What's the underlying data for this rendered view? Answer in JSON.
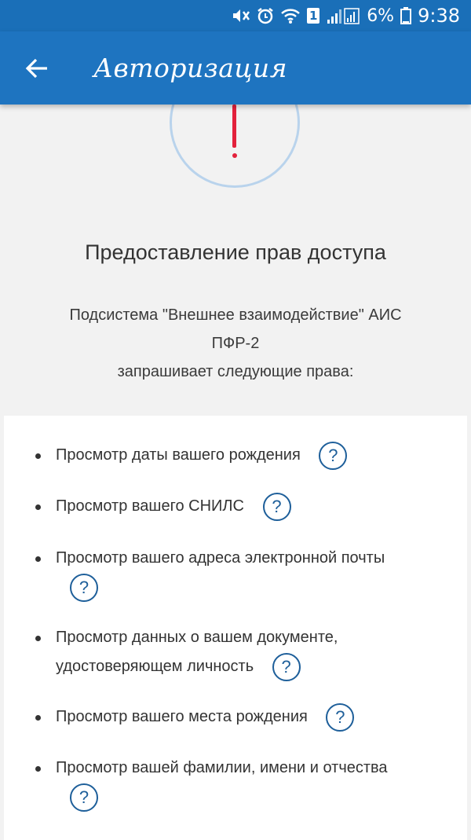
{
  "status_bar": {
    "sim_badge": "1",
    "battery": "6%",
    "time": "9:38"
  },
  "app_bar": {
    "title": "Авторизация"
  },
  "main": {
    "heading": "Предоставление прав доступа",
    "subtext_lines": [
      "Подсистема \"Внешнее взаимодействие\" АИС",
      "ПФР-2",
      "запрашивает следующие права:"
    ]
  },
  "permissions": [
    {
      "label": "Просмотр даты вашего рождения",
      "help": "?"
    },
    {
      "label": "Просмотр вашего СНИЛС",
      "help": "?"
    },
    {
      "label": "Просмотр вашего адреса электронной почты",
      "help": "?"
    },
    {
      "label": "Просмотр данных о вашем документе, удостоверяющем личность",
      "help": "?"
    },
    {
      "label": "Просмотр вашего места рождения",
      "help": "?"
    },
    {
      "label": "Просмотр вашей фамилии, имени и отчества",
      "help": "?"
    }
  ],
  "colors": {
    "app_bar": "#1e74c0",
    "status_bar": "#1a6fb8",
    "alert_red": "#e3213c",
    "help_blue": "#1e5f9a"
  }
}
